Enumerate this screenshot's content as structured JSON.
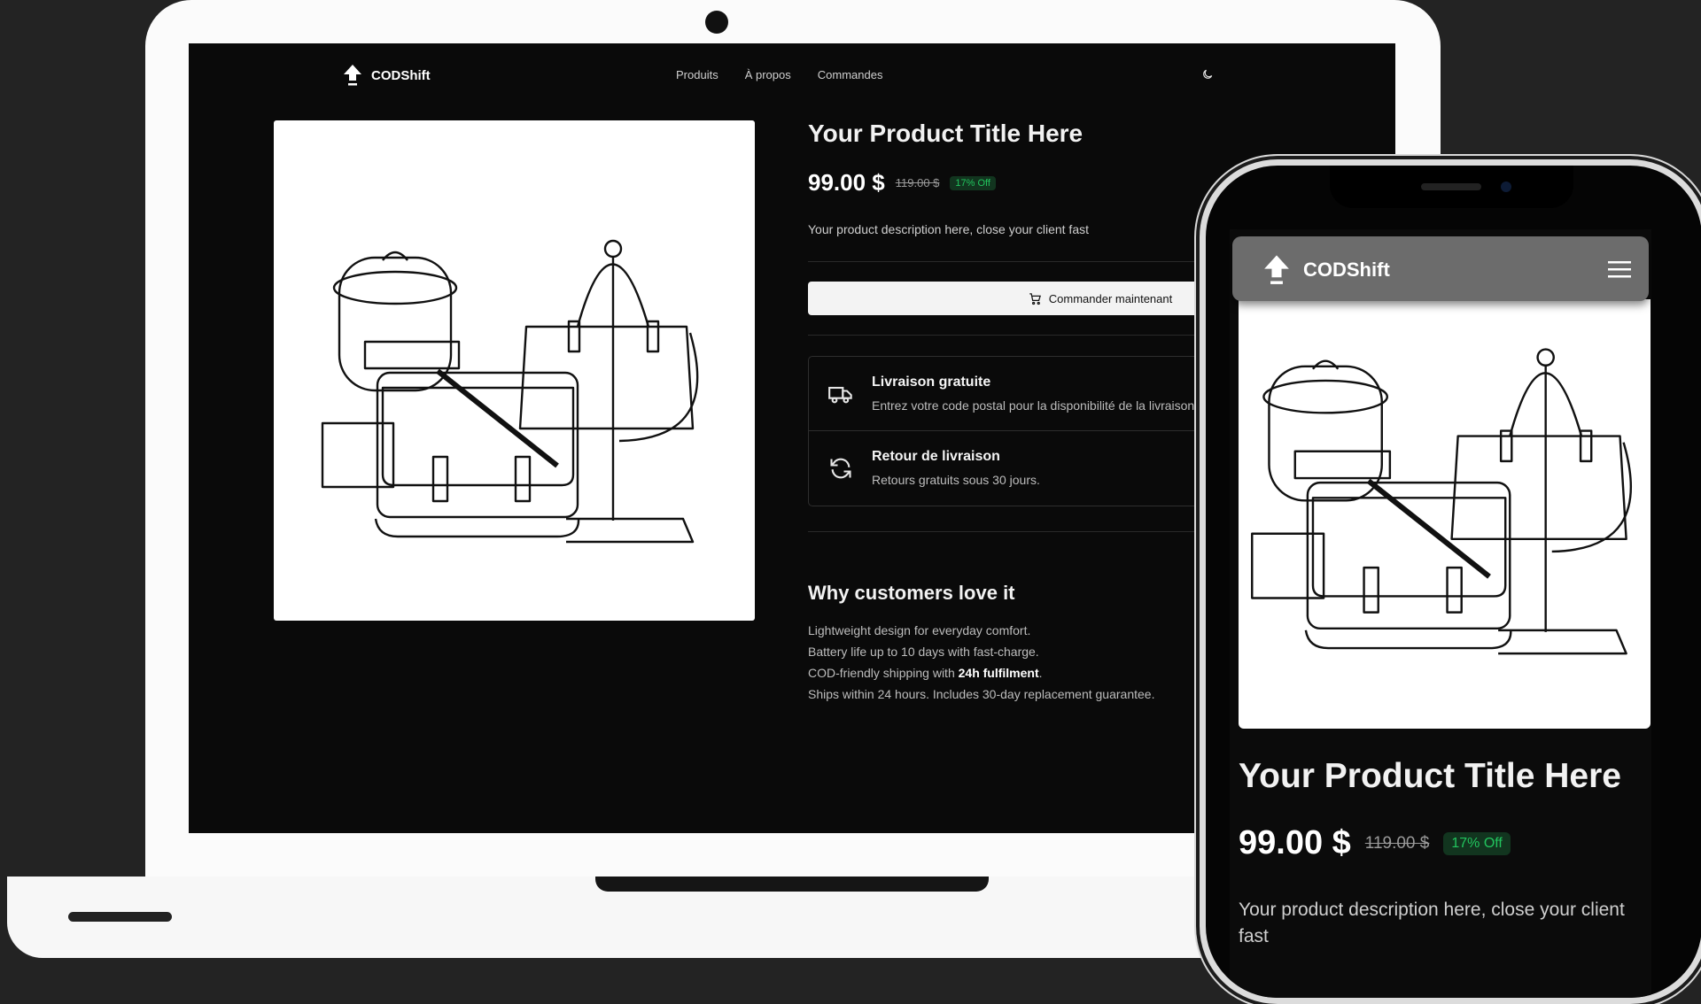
{
  "brand": {
    "name": "CODShift"
  },
  "nav": {
    "links": [
      "Produits",
      "À propos",
      "Commandes"
    ]
  },
  "product": {
    "title": "Your Product Title Here",
    "price": "99.00 $",
    "old_price": "119.00 $",
    "discount": "17% Off",
    "description": "Your product description here, close your client fast",
    "order_label": "Commander maintenant"
  },
  "info": [
    {
      "icon": "truck-icon",
      "title": "Livraison gratuite",
      "subtitle": "Entrez votre code postal pour la disponibilité de la livraison"
    },
    {
      "icon": "refresh-icon",
      "title": "Retour de livraison",
      "subtitle": "Retours gratuits sous 30 jours."
    }
  ],
  "why": {
    "title": "Why customers love it",
    "items": [
      "Lightweight design for everyday comfort.",
      "Battery life up to 10 days with fast-charge.",
      {
        "prefix": "COD-friendly shipping with ",
        "bold": "24h fulfilment",
        "suffix": "."
      },
      "Ships within 24 hours. Includes 30-day replacement guarantee."
    ]
  },
  "colors": {
    "background": "#0a0a0a",
    "accent_green": "#22c55e",
    "button_bg": "#f3f3f3"
  }
}
